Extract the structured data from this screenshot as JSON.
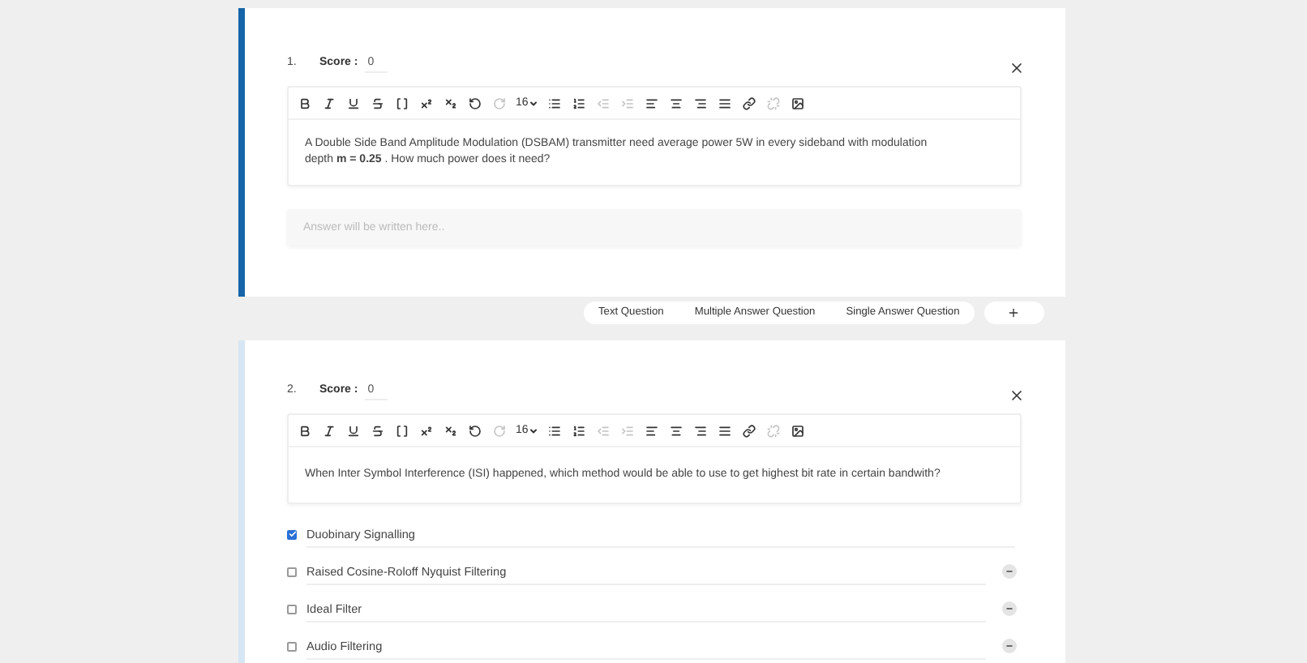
{
  "questions": [
    {
      "number": "1.",
      "score_label": "Score :",
      "score": "0",
      "active": true,
      "toolbar": [
        {
          "kind": "bold",
          "disabled": false
        },
        {
          "kind": "italic",
          "disabled": false
        },
        {
          "kind": "underline",
          "disabled": false
        },
        {
          "kind": "strike",
          "disabled": false
        },
        {
          "kind": "braces",
          "disabled": false
        },
        {
          "kind": "superscript",
          "disabled": false
        },
        {
          "kind": "subscript",
          "disabled": false
        },
        {
          "kind": "undo",
          "disabled": false
        },
        {
          "kind": "redo",
          "disabled": true
        },
        {
          "kind": "font-size",
          "label": "16",
          "disabled": false
        },
        {
          "kind": "bullets",
          "disabled": false
        },
        {
          "kind": "numbers",
          "disabled": false
        },
        {
          "kind": "outdent",
          "disabled": true
        },
        {
          "kind": "indent",
          "disabled": true
        },
        {
          "kind": "align-left",
          "disabled": false
        },
        {
          "kind": "align-center",
          "disabled": false
        },
        {
          "kind": "align-right",
          "disabled": false
        },
        {
          "kind": "justify",
          "disabled": false
        },
        {
          "kind": "link",
          "disabled": false
        },
        {
          "kind": "unlink",
          "disabled": true
        },
        {
          "kind": "image",
          "disabled": false
        }
      ],
      "text": "A Double Side Band Amplitude Modulation (DSBAM) transmitter need average power 5W in every sideband with modulation depth **m = 0.25** . How much power does it need?",
      "answer": {
        "kind": "text",
        "placeholder": "Answer will be written here.."
      }
    },
    {
      "number": "2.",
      "score_label": "Score :",
      "score": "0",
      "active": false,
      "toolbar": [
        {
          "kind": "bold",
          "disabled": false
        },
        {
          "kind": "italic",
          "disabled": false
        },
        {
          "kind": "underline",
          "disabled": false
        },
        {
          "kind": "strike",
          "disabled": false
        },
        {
          "kind": "braces",
          "disabled": false
        },
        {
          "kind": "superscript",
          "disabled": false
        },
        {
          "kind": "subscript",
          "disabled": false
        },
        {
          "kind": "undo",
          "disabled": false
        },
        {
          "kind": "redo",
          "disabled": true
        },
        {
          "kind": "font-size",
          "label": "16",
          "disabled": false
        },
        {
          "kind": "bullets",
          "disabled": false
        },
        {
          "kind": "numbers",
          "disabled": false
        },
        {
          "kind": "outdent",
          "disabled": true
        },
        {
          "kind": "indent",
          "disabled": true
        },
        {
          "kind": "align-left",
          "disabled": false
        },
        {
          "kind": "align-center",
          "disabled": false
        },
        {
          "kind": "align-right",
          "disabled": false
        },
        {
          "kind": "justify",
          "disabled": false
        },
        {
          "kind": "link",
          "disabled": false
        },
        {
          "kind": "unlink",
          "disabled": true
        },
        {
          "kind": "image",
          "disabled": false
        }
      ],
      "text": "When Inter Symbol Interference (ISI) happened, which method would be able to use to get highest bit rate in certain bandwith?",
      "answer": {
        "kind": "options",
        "options": [
          {
            "label": "Duobinary Signalling",
            "checked": true,
            "removable": false
          },
          {
            "label": "Raised Cosine-Roloff Nyquist Filtering",
            "checked": false,
            "removable": true
          },
          {
            "label": "Ideal Filter",
            "checked": false,
            "removable": true
          },
          {
            "label": "Audio Filtering",
            "checked": false,
            "removable": true
          }
        ]
      }
    }
  ],
  "question_types": [
    "Text Question",
    "Multiple Answer Question",
    "Single Answer Question"
  ]
}
